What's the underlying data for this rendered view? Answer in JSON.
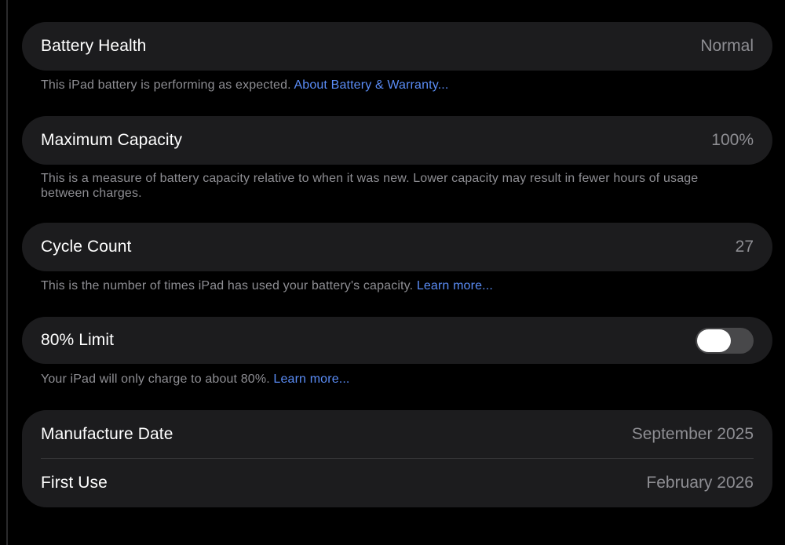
{
  "battery_health": {
    "label": "Battery Health",
    "value": "Normal",
    "footnote_text": "This iPad battery is performing as expected. ",
    "footnote_link": "About Battery & Warranty..."
  },
  "maximum_capacity": {
    "label": "Maximum Capacity",
    "value": "100%",
    "footnote_text": "This is a measure of battery capacity relative to when it was new. Lower capacity may result in fewer hours of usage between charges."
  },
  "cycle_count": {
    "label": "Cycle Count",
    "value": "27",
    "footnote_text": "This is the number of times iPad has used your battery's capacity. ",
    "footnote_link": "Learn more..."
  },
  "limit_80": {
    "label": "80% Limit",
    "toggle_on": false,
    "footnote_text": "Your iPad will only charge to about 80%. ",
    "footnote_link": "Learn more..."
  },
  "dates": {
    "manufacture_label": "Manufacture Date",
    "manufacture_value": "September 2025",
    "first_use_label": "First Use",
    "first_use_value": "February 2026"
  },
  "colors": {
    "background": "#000000",
    "card": "#1c1c1e",
    "secondary_text": "#8e8e93",
    "link": "#5a8cf5",
    "toggle_off": "#48484a"
  }
}
